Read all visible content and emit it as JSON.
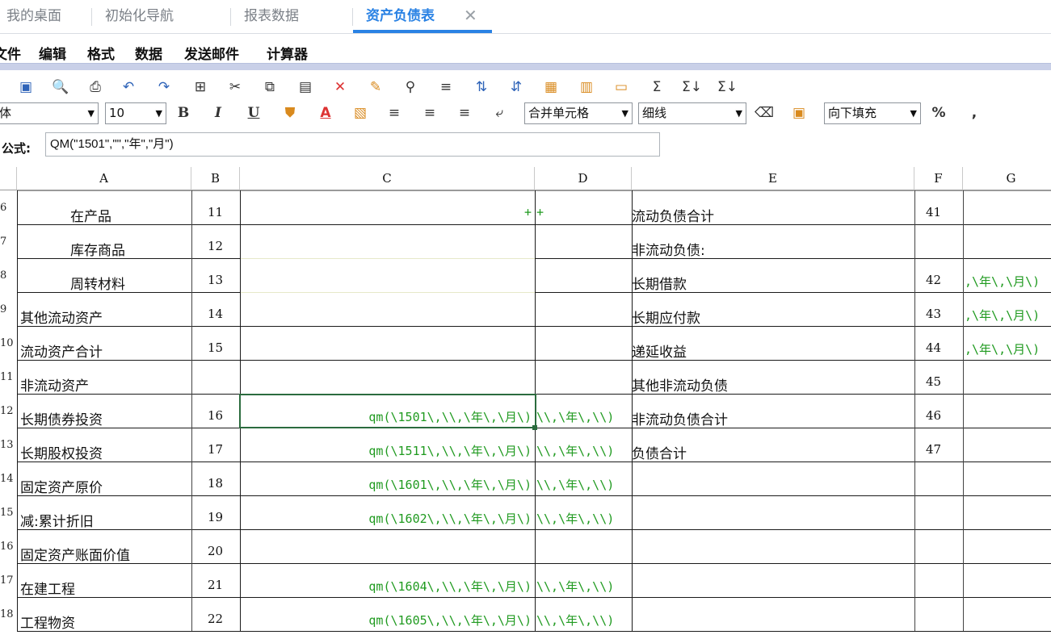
{
  "tabs": [
    {
      "label": "我的桌面",
      "active": false
    },
    {
      "label": "初始化导航",
      "active": false
    },
    {
      "label": "报表数据",
      "active": false
    },
    {
      "label": "资产负债表",
      "active": true
    }
  ],
  "menu": [
    "文件",
    "编辑",
    "格式",
    "数据",
    "发送邮件",
    "计算器"
  ],
  "toolbar": {
    "font_name": "体",
    "font_size": "10",
    "merge_select": "合并单元格",
    "line_select": "细线",
    "fill_select": "向下填充",
    "percent": "%",
    "comma": ","
  },
  "formula": {
    "label": "公式:",
    "value": "QM(\"1501\",\"\",\"年\",\"月\")"
  },
  "columns": [
    "A",
    "B",
    "C",
    "D",
    "E",
    "F",
    "G"
  ],
  "rows": [
    {
      "num": "6",
      "a": "在产品",
      "indent": true,
      "b": "11",
      "c": "+",
      "d": "+",
      "e": "流动负债合计",
      "f": "41",
      "g": ""
    },
    {
      "num": "7",
      "a": "库存商品",
      "indent": true,
      "b": "12",
      "c": "",
      "d": "",
      "e": "非流动负债:",
      "f": "",
      "g": ""
    },
    {
      "num": "8",
      "a": "周转材料",
      "indent": true,
      "b": "13",
      "c": "",
      "d": "",
      "e": "长期借款",
      "f": "42",
      "g": ",\\年\\,\\月\\)"
    },
    {
      "num": "9",
      "a": "其他流动资产",
      "indent": false,
      "b": "14",
      "c": "",
      "d": "",
      "e": "长期应付款",
      "f": "43",
      "g": ",\\年\\,\\月\\)"
    },
    {
      "num": "10",
      "a": "流动资产合计",
      "indent": false,
      "b": "15",
      "c": "",
      "d": "",
      "e": "递延收益",
      "f": "44",
      "g": ",\\年\\,\\月\\)"
    },
    {
      "num": "11",
      "a": "非流动资产",
      "indent": false,
      "b": "",
      "c": "",
      "d": "",
      "e": "其他非流动负债",
      "f": "45",
      "g": ""
    },
    {
      "num": "12",
      "a": "长期债券投资",
      "indent": false,
      "b": "16",
      "c": "qm(\\1501\\,\\\\,\\年\\,\\月\\)",
      "d": "\\\\,\\年\\,\\\\)",
      "e": "非流动负债合计",
      "f": "46",
      "g": ""
    },
    {
      "num": "13",
      "a": "长期股权投资",
      "indent": false,
      "b": "17",
      "c": "qm(\\1511\\,\\\\,\\年\\,\\月\\)",
      "d": "\\\\,\\年\\,\\\\)",
      "e": "负债合计",
      "f": "47",
      "g": ""
    },
    {
      "num": "14",
      "a": "固定资产原价",
      "indent": false,
      "b": "18",
      "c": "qm(\\1601\\,\\\\,\\年\\,\\月\\)",
      "d": "\\\\,\\年\\,\\\\)",
      "e": "",
      "f": "",
      "g": ""
    },
    {
      "num": "15",
      "a": "减:累计折旧",
      "indent": false,
      "b": "19",
      "c": "qm(\\1602\\,\\\\,\\年\\,\\月\\)",
      "d": "\\\\,\\年\\,\\\\)",
      "e": "",
      "f": "",
      "g": ""
    },
    {
      "num": "16",
      "a": "固定资产账面价值",
      "indent": false,
      "b": "20",
      "c": "",
      "d": "",
      "e": "",
      "f": "",
      "g": ""
    },
    {
      "num": "17",
      "a": "在建工程",
      "indent": false,
      "b": "21",
      "c": "qm(\\1604\\,\\\\,\\年\\,\\月\\)",
      "d": "\\\\,\\年\\,\\\\)",
      "e": "",
      "f": "",
      "g": ""
    },
    {
      "num": "18",
      "a": "工程物资",
      "indent": false,
      "b": "22",
      "c": "qm(\\1605\\,\\\\,\\年\\,\\月\\)",
      "d": "\\\\,\\年\\,\\\\)",
      "e": "",
      "f": "",
      "g": ""
    }
  ]
}
